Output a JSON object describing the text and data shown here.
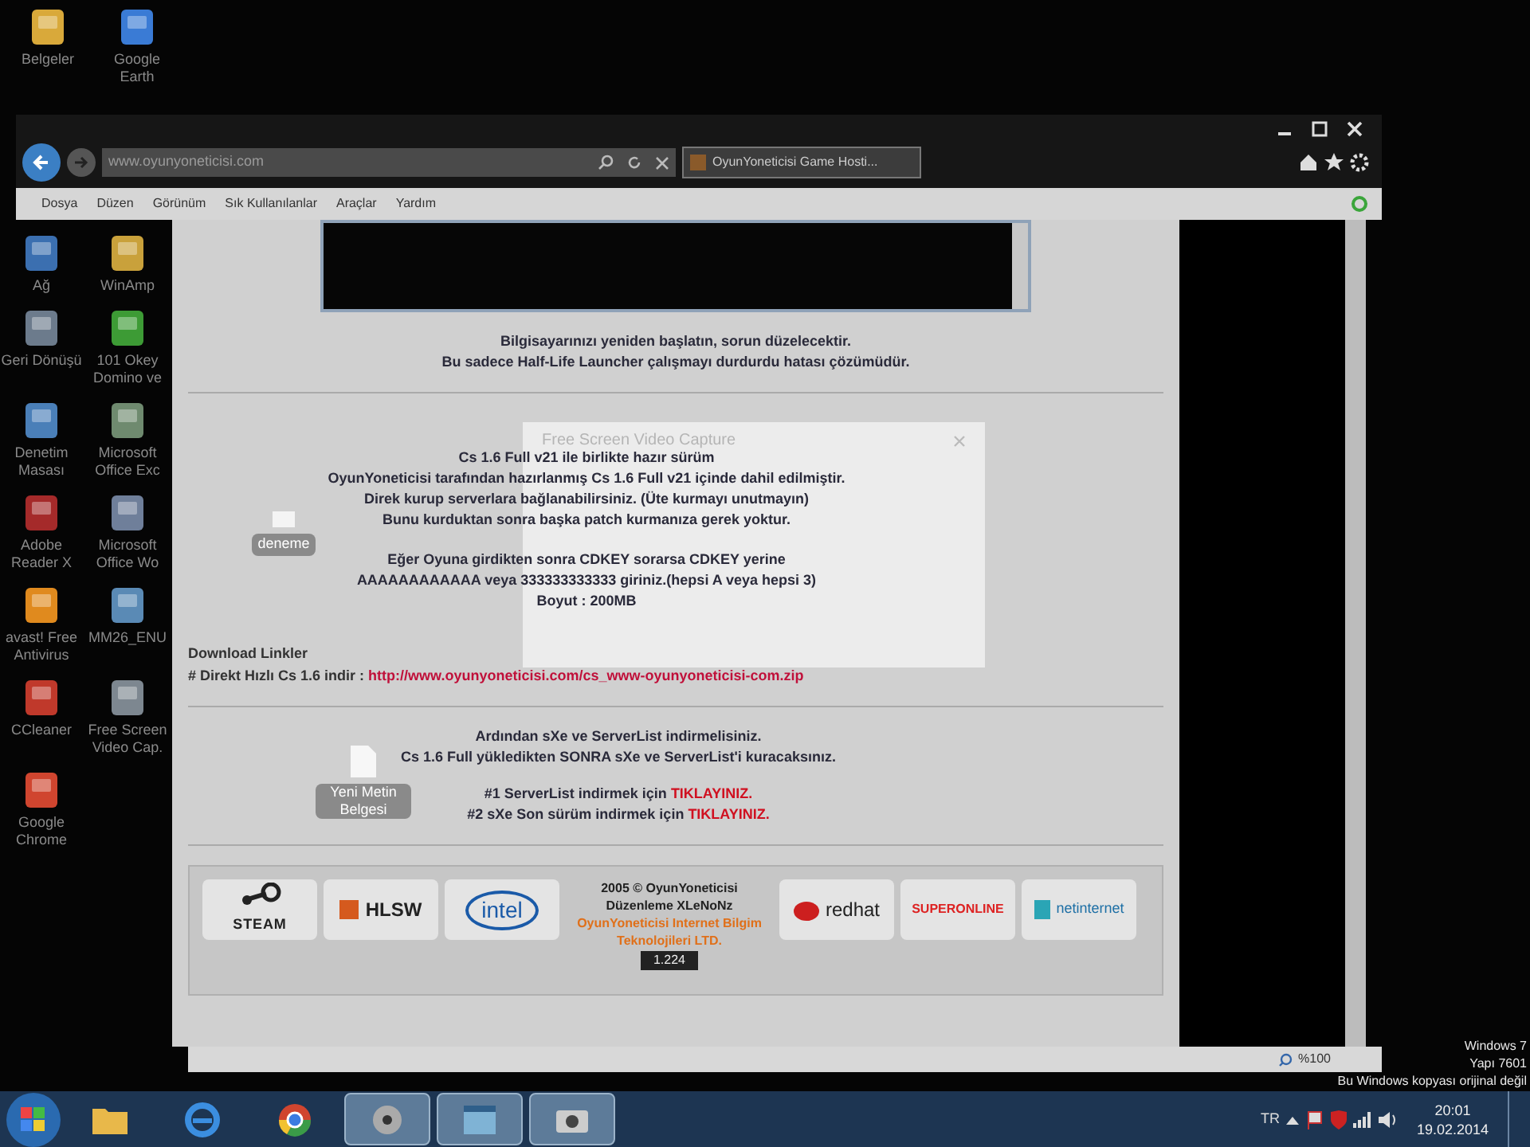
{
  "desktop_top": [
    {
      "label": "Belgeler",
      "color": "#d9a93a"
    },
    {
      "label": "Google Earth",
      "color": "#3a7bd5"
    }
  ],
  "browser": {
    "address": "www.oyunyoneticisi.com",
    "tab": "OyunYoneticisi Game Hosti...",
    "menu": [
      "Dosya",
      "Düzen",
      "Görünüm",
      "Sık Kullanılanlar",
      "Araçlar",
      "Yardım"
    ],
    "zoom": "%100"
  },
  "desktop_icons": [
    {
      "label": "Ağ",
      "color": "#3b6fb0"
    },
    {
      "label": "WinAmp",
      "color": "#c9a13b"
    },
    {
      "label": "Geri Dönüşü",
      "color": "#6c7b8c"
    },
    {
      "label": "101 Okey Domino ve",
      "color": "#3d9b35"
    },
    {
      "label": "Denetim Masası",
      "color": "#4a7fb8"
    },
    {
      "label": "Microsoft Office Exc",
      "color": "#6f8a6f"
    },
    {
      "label": "Adobe Reader X",
      "color": "#a52a2a"
    },
    {
      "label": "Microsoft Office Wo",
      "color": "#6f7f9a"
    },
    {
      "label": "avast! Free Antivirus",
      "color": "#e08a1e"
    },
    {
      "label": "MM26_ENU",
      "color": "#5a8ab5"
    },
    {
      "label": "CCleaner",
      "color": "#c0392b"
    },
    {
      "label": "Free Screen Video Cap.",
      "color": "#7d8790"
    },
    {
      "label": "Google Chrome",
      "color": "#d0452f"
    }
  ],
  "page": {
    "notice": [
      "Bilgisayarınızı yeniden başlatın, sorun düzelecektir.",
      "Bu sadece Half-Life Launcher çalışmayı durdurdu hatası çözümüdür."
    ],
    "section1_icon": "deneme",
    "section1": [
      "Cs 1.6 Full v21 ile birlikte hazır sürüm",
      "OyunYoneticisi tarafından hazırlanmış Cs 1.6 Full v21 içinde dahil edilmiştir.",
      "Direk kurup serverlara bağlanabilirsiniz. (Üte kurmayı unutmayın)",
      "Bunu kurduktan sonra başka patch kurmanıza gerek yoktur."
    ],
    "cdkey": [
      "Eğer Oyuna girdikten sonra CDKEY sorarsa CDKEY yerine",
      "AAAAAAAAAAAA veya 333333333333 giriniz.(hepsi A veya hepsi 3)",
      "Boyut : 200MB"
    ],
    "download_title": "Download Linkler",
    "download_label": "# Direkt Hızlı Cs 1.6 indir : ",
    "download_link": "http://www.oyunyoneticisi.com/cs_www-oyunyoneticisi-com.zip",
    "section2_icon": "Yeni Metin Belgesi",
    "section2": [
      "Ardından sXe ve ServerList indirmelisiniz.",
      "Cs 1.6 Full yükledikten SONRA sXe ve ServerList'i kuracaksınız."
    ],
    "links": [
      {
        "text": "#1 ServerList indirmek için ",
        "link": "TIKLAYINIZ."
      },
      {
        "text": "#2 sXe Son sürüm indirmek için ",
        "link": "TIKLAYINIZ."
      }
    ],
    "footer": {
      "left_logos": [
        {
          "kind": "steam",
          "text": "STEAM"
        },
        {
          "kind": "hlsw",
          "text": "HLSW"
        },
        {
          "kind": "intel",
          "text": "intel"
        }
      ],
      "credits": [
        "2005 © OyunYoneticisi",
        "Düzenleme XLeNoNz"
      ],
      "company": [
        "OyunYoneticisi Internet Bilgim",
        "Teknolojileri LTD."
      ],
      "counter": "1.224",
      "right_logos": [
        {
          "kind": "redhat",
          "text": "redhat"
        },
        {
          "kind": "superonline",
          "text": "SUPERONLINE"
        },
        {
          "kind": "netinternet",
          "text": "netinternet"
        }
      ]
    }
  },
  "overlay": {
    "title": "Free Screen Video Capture"
  },
  "watermark": [
    "Windows 7",
    "Yapı 7601",
    "Bu Windows kopyası orijinal değil"
  ],
  "taskbar": {
    "apps": [
      {
        "kind": "folder",
        "open": false
      },
      {
        "kind": "ie",
        "open": false
      },
      {
        "kind": "chrome",
        "open": false
      },
      {
        "kind": "media",
        "open": true
      },
      {
        "kind": "window",
        "open": true
      },
      {
        "kind": "camera",
        "open": true
      }
    ],
    "language": "TR",
    "time": "20:01",
    "date": "19.02.2014"
  }
}
